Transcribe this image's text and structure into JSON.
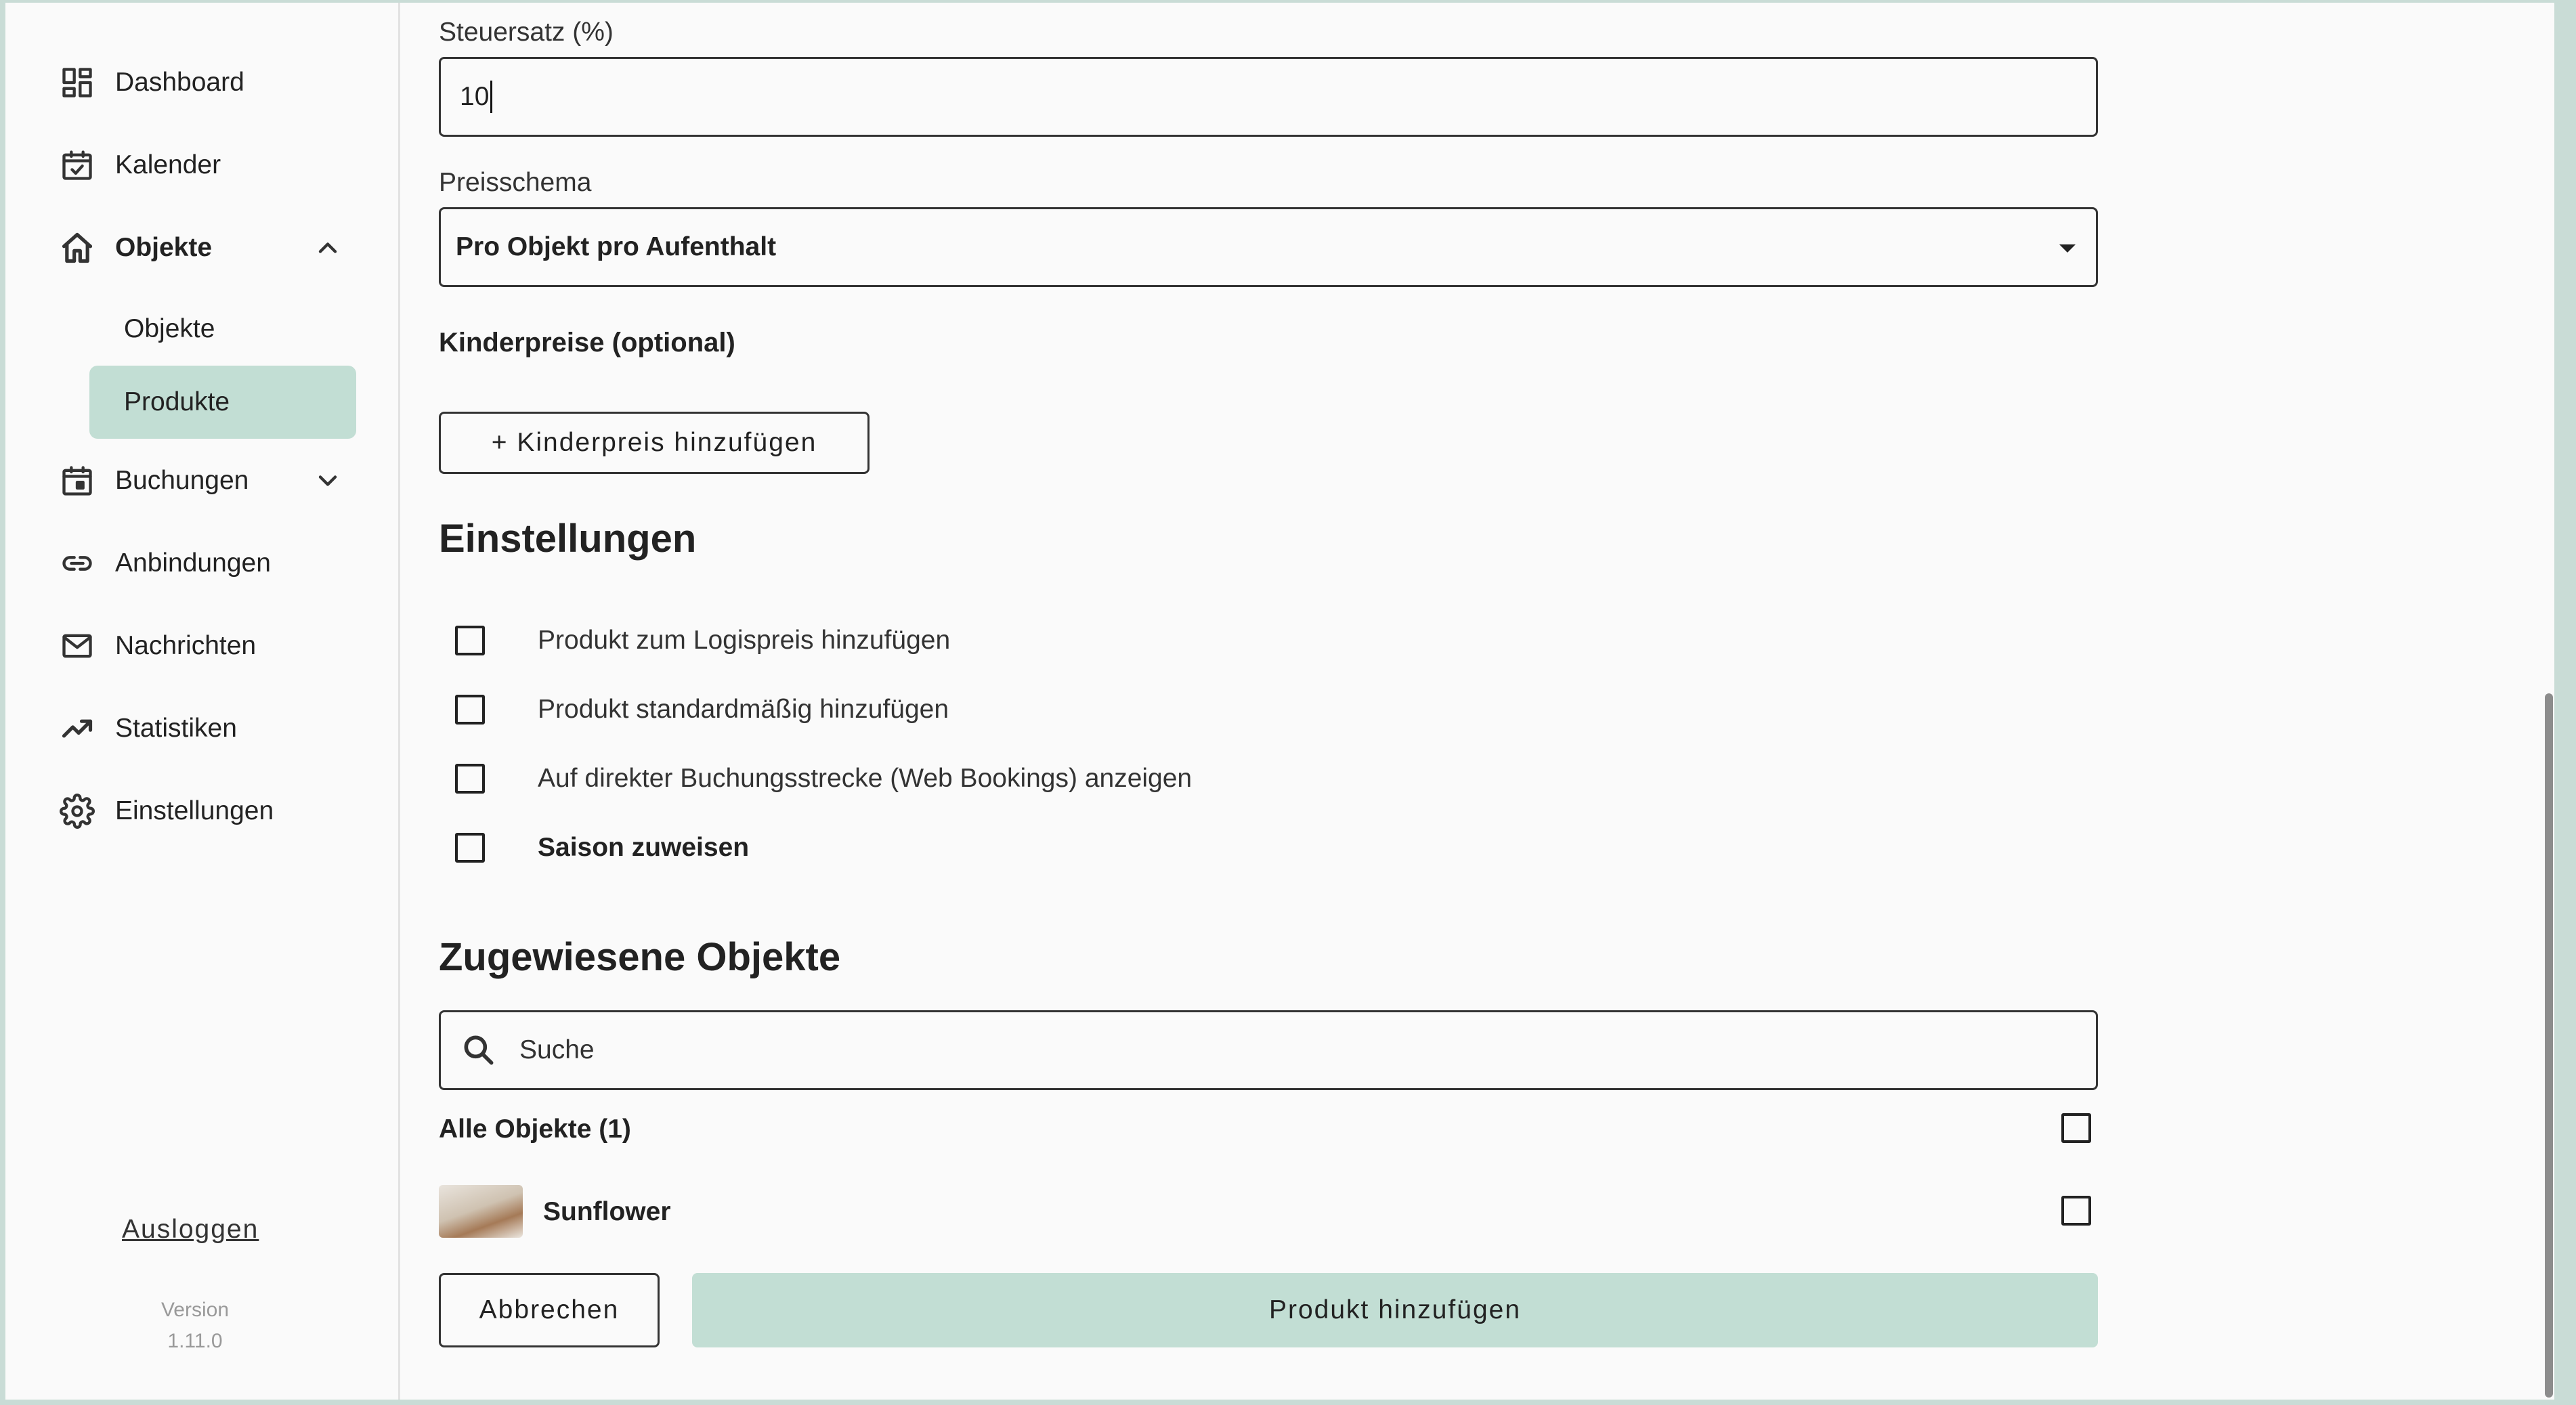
{
  "sidebar": {
    "items": [
      {
        "label": "Dashboard",
        "icon": "dashboard-icon"
      },
      {
        "label": "Kalender",
        "icon": "calendar-check-icon"
      },
      {
        "label": "Objekte",
        "icon": "home-icon",
        "expanded": true
      },
      {
        "label": "Buchungen",
        "icon": "calendar-icon",
        "expanded": false
      },
      {
        "label": "Anbindungen",
        "icon": "link-icon"
      },
      {
        "label": "Nachrichten",
        "icon": "mail-icon"
      },
      {
        "label": "Statistiken",
        "icon": "trending-up-icon"
      },
      {
        "label": "Einstellungen",
        "icon": "gear-icon"
      }
    ],
    "subitems": [
      {
        "label": "Objekte",
        "active": false
      },
      {
        "label": "Produkte",
        "active": true
      }
    ],
    "logout_label": "Ausloggen",
    "version_label": "Version",
    "version_value": "1.11.0"
  },
  "form": {
    "tax_label": "Steuersatz (%)",
    "tax_value": "10",
    "pricing_label": "Preisschema",
    "pricing_value": "Pro Objekt pro Aufenthalt",
    "child_prices_label": "Kinderpreise (optional)",
    "add_child_price_button": "+ Kinderpreis hinzufügen"
  },
  "settings": {
    "title": "Einstellungen",
    "options": [
      {
        "label": "Produkt zum Logispreis hinzufügen",
        "checked": false
      },
      {
        "label": "Produkt standardmäßig hinzufügen",
        "checked": false
      },
      {
        "label": "Auf direkter Buchungsstrecke (Web Bookings) anzeigen",
        "checked": false
      },
      {
        "label": "Saison zuweisen",
        "checked": false
      }
    ]
  },
  "assigned": {
    "title": "Zugewiesene Objekte",
    "search_placeholder": "Suche",
    "all_label": "Alle Objekte (1)",
    "objects": [
      {
        "name": "Sunflower",
        "checked": false
      }
    ]
  },
  "actions": {
    "cancel_label": "Abbrechen",
    "submit_label": "Produkt hinzufügen"
  },
  "colors": {
    "accent": "#c2ded4",
    "border": "#333333",
    "background": "#fafafa"
  }
}
